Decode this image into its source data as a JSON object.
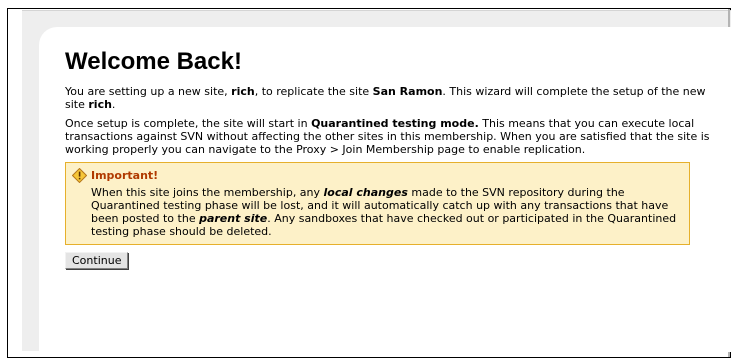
{
  "page": {
    "title": "Welcome Back!"
  },
  "intro": {
    "t1": "You are setting up a new site, ",
    "site_name": "rich",
    "t2": ", to replicate the site ",
    "source_site": "San Ramon",
    "t3": ". This wizard will complete the setup of the new site ",
    "site_name_2": "rich",
    "t4": "."
  },
  "mode": {
    "t1": "Once setup is complete, the site will start in ",
    "mode_name": "Quarantined testing mode.",
    "t2": " This means that you can execute local transactions against SVN without affecting the other sites in this membership. When you are satisfied that the site is working properly you can navigate to the Proxy > Join Membership page to enable replication."
  },
  "warning": {
    "title": "Important!",
    "t1": "When this site joins the membership, any ",
    "em1": "local changes",
    "t2": " made to the SVN repository during the Quarantined testing phase will be lost, and it will automatically catch up with any transactions that have been posted to the ",
    "em2": "parent site",
    "t3": ". Any sandboxes that have checked out or participated in the Quarantined testing phase should be deleted.",
    "icon": "warning-diamond-icon",
    "accent_color": "#b03a00",
    "border_color": "#e6b02c",
    "background_color": "#fdf1c8"
  },
  "actions": {
    "continue_label": "Continue"
  }
}
